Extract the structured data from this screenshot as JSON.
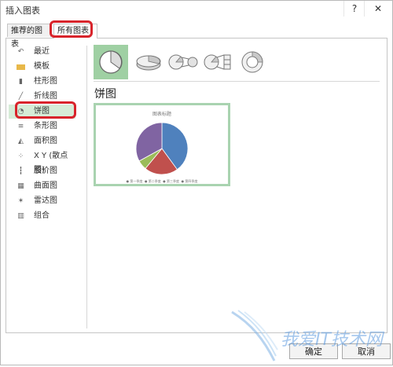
{
  "window": {
    "title": "插入图表",
    "help_glyph": "?",
    "close_glyph": "✕"
  },
  "tabs": [
    {
      "label": "推荐的图表",
      "active": false
    },
    {
      "label": "所有图表",
      "active": true
    }
  ],
  "sidebar": {
    "items": [
      {
        "label": "最近",
        "icon": "undo-icon"
      },
      {
        "label": "模板",
        "icon": "folder-icon"
      },
      {
        "label": "柱形图",
        "icon": "column-chart-icon"
      },
      {
        "label": "折线图",
        "icon": "line-chart-icon"
      },
      {
        "label": "饼图",
        "icon": "pie-chart-icon",
        "selected": true
      },
      {
        "label": "条形图",
        "icon": "bar-chart-icon"
      },
      {
        "label": "面积图",
        "icon": "area-chart-icon"
      },
      {
        "label": "X Y (散点图)",
        "icon": "scatter-chart-icon"
      },
      {
        "label": "股价图",
        "icon": "stock-chart-icon"
      },
      {
        "label": "曲面图",
        "icon": "surface-chart-icon"
      },
      {
        "label": "雷达图",
        "icon": "radar-chart-icon"
      },
      {
        "label": "组合",
        "icon": "combo-chart-icon"
      }
    ]
  },
  "subtypes": [
    "pie-icon",
    "3d-pie-icon",
    "pie-of-pie-icon",
    "bar-of-pie-icon",
    "doughnut-icon"
  ],
  "subtype_title": "饼图",
  "preview": {
    "title": "图表标题",
    "legend": [
      "第一季度",
      "第二季度",
      "第三季度",
      "第四季度"
    ],
    "slices": [
      {
        "value": 40,
        "color": "#4f81bd"
      },
      {
        "value": 21,
        "color": "#c0504d"
      },
      {
        "value": 6,
        "color": "#9bbb59"
      },
      {
        "value": 33,
        "color": "#8064a2"
      }
    ]
  },
  "buttons": {
    "ok": "确定",
    "cancel": "取消"
  },
  "colors": {
    "accent_selected": "#d6ecd7",
    "annotation_red": "#d8242b"
  },
  "watermark": "我爱IT技术网"
}
